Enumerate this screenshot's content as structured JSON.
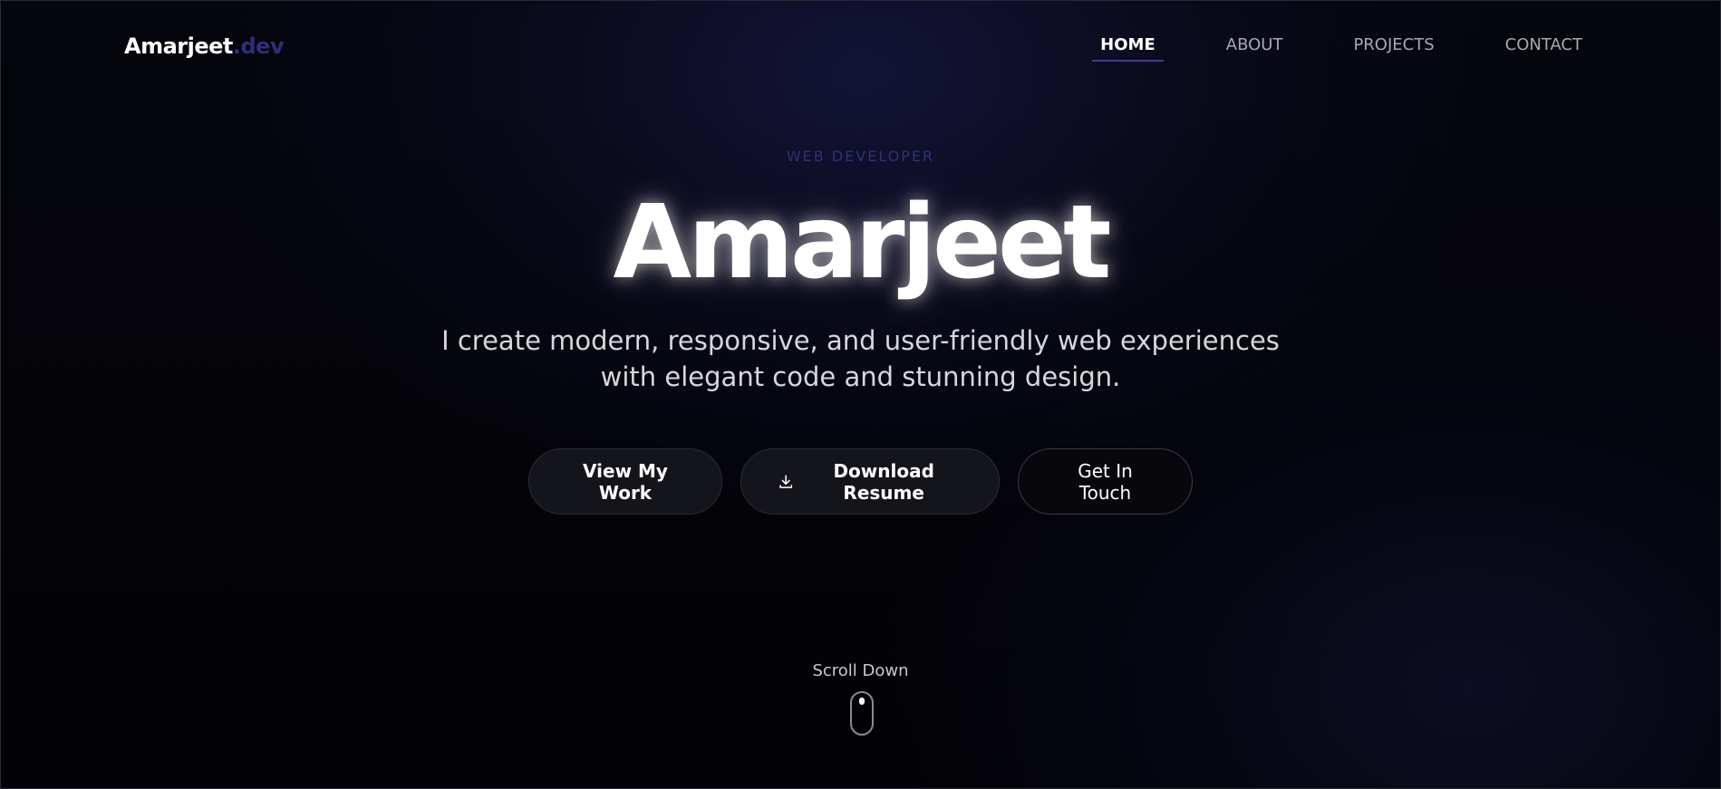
{
  "header": {
    "logo_name": "Amarjeet",
    "logo_suffix": ".dev",
    "nav": [
      "HOME",
      "ABOUT",
      "PROJECTS",
      "CONTACT"
    ],
    "active_nav": "HOME"
  },
  "hero": {
    "role": "WEB DEVELOPER",
    "name": "Amarjeet",
    "tagline_line1": "I create modern, responsive, and user-friendly web experiences",
    "tagline_line2": "with elegant code and stunning design."
  },
  "buttons": {
    "view_work": "View My Work",
    "download_resume": "Download Resume",
    "get_in_touch": "Get In Touch"
  },
  "scroll": {
    "label": "Scroll Down"
  },
  "colors": {
    "accent": "#2e2f78",
    "background": "#000000",
    "text": "#ffffff"
  },
  "icons": {
    "download": "download-icon",
    "mouse": "mouse-scroll-icon"
  }
}
